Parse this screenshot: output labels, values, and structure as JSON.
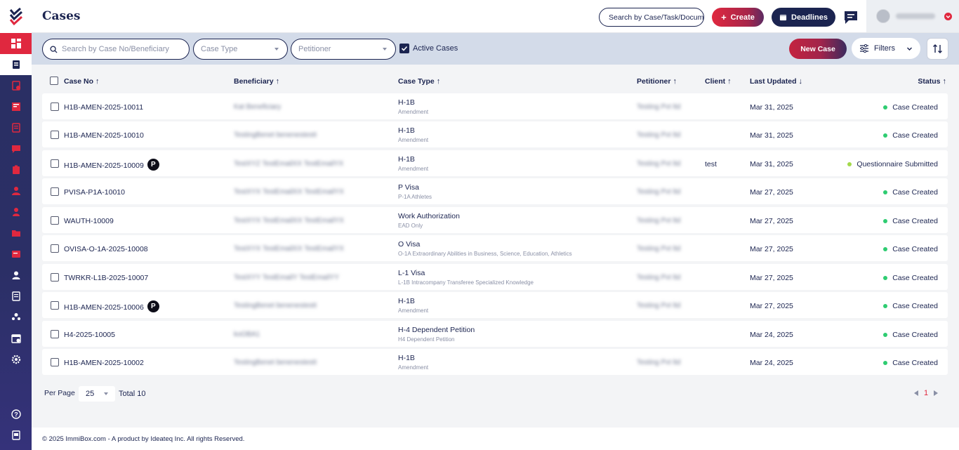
{
  "header": {
    "title": "Cases",
    "search_placeholder": "Search by Case/Task/Document",
    "create_label": "Create",
    "deadlines_label": "Deadlines"
  },
  "filters": {
    "search_placeholder": "Search by Case No/Beneficiary",
    "case_type_placeholder": "Case Type",
    "petitioner_placeholder": "Petitioner",
    "active_cases_label": "Active Cases",
    "active_cases_checked": true,
    "new_case_label": "New Case",
    "filters_label": "Filters"
  },
  "table": {
    "columns": {
      "case_no": "Case No",
      "beneficiary": "Beneficiary",
      "case_type": "Case Type",
      "petitioner": "Petitioner",
      "client": "Client",
      "last_updated": "Last Updated",
      "status": "Status"
    },
    "rows": [
      {
        "case_no": "H1B-AMEN-2025-10011",
        "badge": "",
        "beneficiary": "Kat Beneficiary",
        "type": "H-1B",
        "subtype": "Amendment",
        "petitioner": "Testing Pvt ltd",
        "client": "",
        "updated": "Mar 31, 2025",
        "status": "Case Created",
        "status_color": "#2ecc71"
      },
      {
        "case_no": "H1B-AMEN-2025-10010",
        "badge": "",
        "beneficiary": "TestingBenet benenestestt",
        "type": "H-1B",
        "subtype": "Amendment",
        "petitioner": "Testing Pvt ltd",
        "client": "",
        "updated": "Mar 31, 2025",
        "status": "Case Created",
        "status_color": "#2ecc71"
      },
      {
        "case_no": "H1B-AMEN-2025-10009",
        "badge": "P",
        "beneficiary": "TestXYZ TestEmailXX TestEmailYX",
        "type": "H-1B",
        "subtype": "Amendment",
        "petitioner": "Testing Pvt ltd",
        "client": "test",
        "updated": "Mar 31, 2025",
        "status": "Questionnaire Submitted",
        "status_color": "#a3d94b"
      },
      {
        "case_no": "PVISA-P1A-10010",
        "badge": "",
        "beneficiary": "TestXYX TestEmailXX TestEmailYX",
        "type": "P Visa",
        "subtype": "P-1A Athletes",
        "petitioner": "Testing Pvt ltd",
        "client": "",
        "updated": "Mar 27, 2025",
        "status": "Case Created",
        "status_color": "#2ecc71"
      },
      {
        "case_no": "WAUTH-10009",
        "badge": "",
        "beneficiary": "TestXYX TestEmailXX TestEmailYX",
        "type": "Work Authorization",
        "subtype": "EAD Only",
        "petitioner": "Testing Pvt ltd",
        "client": "",
        "updated": "Mar 27, 2025",
        "status": "Case Created",
        "status_color": "#2ecc71"
      },
      {
        "case_no": "OVISA-O-1A-2025-10008",
        "badge": "",
        "beneficiary": "TestXYX TestEmailXX TestEmailYX",
        "type": "O Visa",
        "subtype": "O-1A Extraordinary Abilities in Business, Science, Education, Athletics",
        "petitioner": "Testing Pvt ltd",
        "client": "",
        "updated": "Mar 27, 2025",
        "status": "Case Created",
        "status_color": "#2ecc71"
      },
      {
        "case_no": "TWRKR-L1B-2025-10007",
        "badge": "",
        "beneficiary": "TestXYY TestEmailY TestEmailYY",
        "type": "L-1 Visa",
        "subtype": "L-1B Intracompany Transferee Specialized Knowledge",
        "petitioner": "Testing Pvt ltd",
        "client": "",
        "updated": "Mar 27, 2025",
        "status": "Case Created",
        "status_color": "#2ecc71"
      },
      {
        "case_no": "H1B-AMEN-2025-10006",
        "badge": "P",
        "beneficiary": "TestingBenet benenestestt",
        "type": "H-1B",
        "subtype": "Amendment",
        "petitioner": "Testing Pvt ltd",
        "client": "",
        "updated": "Mar 27, 2025",
        "status": "Case Created",
        "status_color": "#2ecc71"
      },
      {
        "case_no": "H4-2025-10005",
        "badge": "",
        "beneficiary": "koOBA1",
        "type": "H-4 Dependent Petition",
        "subtype": "H4 Dependent Petition",
        "petitioner": "",
        "client": "",
        "updated": "Mar 24, 2025",
        "status": "Case Created",
        "status_color": "#2ecc71"
      },
      {
        "case_no": "H1B-AMEN-2025-10002",
        "badge": "",
        "beneficiary": "TestingBenet benenestestt",
        "type": "H-1B",
        "subtype": "Amendment",
        "petitioner": "Testing Pvt ltd",
        "client": "",
        "updated": "Mar 24, 2025",
        "status": "Case Created",
        "status_color": "#2ecc71"
      }
    ]
  },
  "pagination": {
    "per_page_label": "Per Page",
    "per_page_value": "25",
    "total_label": "Total 10",
    "current_page": "1"
  },
  "footer": {
    "text": "© 2025 ImmiBox.com - A product by Ideateq Inc. All rights Reserved."
  },
  "sidebar": {
    "items": [
      "dashboard-icon",
      "cases-icon",
      "tasks-icon",
      "documents-icon",
      "forms-icon",
      "messages-icon",
      "clipboard-icon",
      "beneficiary-icon",
      "petitioner-icon",
      "folder-icon",
      "notes-icon",
      "contacts-icon",
      "reports-icon",
      "team-icon",
      "calendar-icon",
      "settings-icon",
      "help-icon",
      "guide-icon"
    ]
  },
  "colors": {
    "brand_navy": "#1b2450",
    "brand_red": "#e0283f",
    "status_green": "#2ecc71",
    "status_lime": "#a3d94b"
  }
}
